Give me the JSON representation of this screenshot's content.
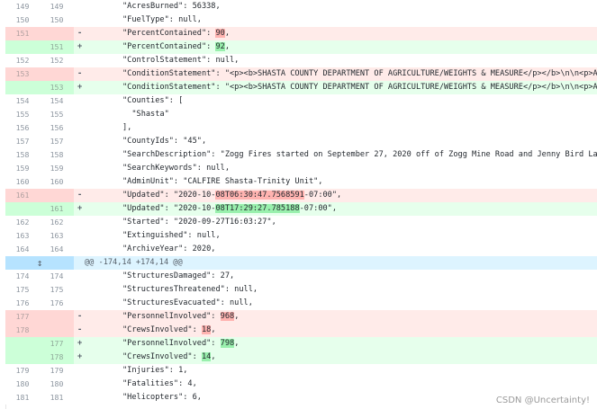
{
  "colors": {
    "del_bg": "#ffebe9",
    "del_gutter": "#ffd7d5",
    "add_bg": "#e6ffec",
    "add_gutter": "#ccffd8",
    "hunk_bg": "#ddf4ff",
    "word_del": "#ffb3b0",
    "word_add": "#99f0ad"
  },
  "expand_icon": "expand-icon",
  "rows": [
    {
      "type": "ctx",
      "old": "149",
      "new": "149",
      "sign": "",
      "pre": "\"AcresBurned\": 56338,",
      "hl": "",
      "post": ""
    },
    {
      "type": "ctx",
      "old": "150",
      "new": "150",
      "sign": "",
      "pre": "\"FuelType\": null,",
      "hl": "",
      "post": ""
    },
    {
      "type": "del",
      "old": "151",
      "new": "",
      "sign": "-",
      "pre": "\"PercentContained\": ",
      "hl": "90",
      "post": ","
    },
    {
      "type": "add",
      "old": "",
      "new": "151",
      "sign": "+",
      "pre": "\"PercentContained\": ",
      "hl": "92",
      "post": ","
    },
    {
      "type": "ctx",
      "old": "152",
      "new": "152",
      "sign": "",
      "pre": "\"ControlStatement\": null,",
      "hl": "",
      "post": ""
    },
    {
      "type": "del",
      "old": "153",
      "new": "",
      "sign": "-",
      "pre": "\"ConditionStatement\": \"<p><b>SHASTA COUNTY DEPARTMENT OF AGRICULTURE/WEIGHTS & MEASURE</p></b>\\n\\n<p>As",
      "hl": "",
      "post": ""
    },
    {
      "type": "add",
      "old": "",
      "new": "153",
      "sign": "+",
      "pre": "\"ConditionStatement\": \"<p><b>SHASTA COUNTY DEPARTMENT OF AGRICULTURE/WEIGHTS & MEASURE</p></b>\\n\\n<p>As",
      "hl": "",
      "post": ""
    },
    {
      "type": "ctx",
      "old": "154",
      "new": "154",
      "sign": "",
      "pre": "\"Counties\": [",
      "hl": "",
      "post": ""
    },
    {
      "type": "ctx",
      "old": "155",
      "new": "155",
      "sign": "",
      "pre": "  \"Shasta\"",
      "hl": "",
      "post": ""
    },
    {
      "type": "ctx",
      "old": "156",
      "new": "156",
      "sign": "",
      "pre": "],",
      "hl": "",
      "post": ""
    },
    {
      "type": "ctx",
      "old": "157",
      "new": "157",
      "sign": "",
      "pre": "\"CountyIds\": \"45\",",
      "hl": "",
      "post": ""
    },
    {
      "type": "ctx",
      "old": "158",
      "new": "158",
      "sign": "",
      "pre": "\"SearchDescription\": \"Zogg Fires started on September 27, 2020 off of Zogg Mine Road and Jenny Bird Lane",
      "hl": "",
      "post": ""
    },
    {
      "type": "ctx",
      "old": "159",
      "new": "159",
      "sign": "",
      "pre": "\"SearchKeywords\": null,",
      "hl": "",
      "post": ""
    },
    {
      "type": "ctx",
      "old": "160",
      "new": "160",
      "sign": "",
      "pre": "\"AdminUnit\": \"CALFIRE Shasta-Trinity Unit\",",
      "hl": "",
      "post": ""
    },
    {
      "type": "del",
      "old": "161",
      "new": "",
      "sign": "-",
      "pre": "\"Updated\": \"2020-10-",
      "hl": "08T06:30:47.7568591",
      "post": "-07:00\","
    },
    {
      "type": "add",
      "old": "",
      "new": "161",
      "sign": "+",
      "pre": "\"Updated\": \"2020-10-",
      "hl": "08T17:29:27.785188",
      "post": "-07:00\","
    },
    {
      "type": "ctx",
      "old": "162",
      "new": "162",
      "sign": "",
      "pre": "\"Started\": \"2020-09-27T16:03:27\",",
      "hl": "",
      "post": ""
    },
    {
      "type": "ctx",
      "old": "163",
      "new": "163",
      "sign": "",
      "pre": "\"Extinguished\": null,",
      "hl": "",
      "post": ""
    },
    {
      "type": "ctx",
      "old": "164",
      "new": "164",
      "sign": "",
      "pre": "\"ArchiveYear\": 2020,",
      "hl": "",
      "post": ""
    },
    {
      "type": "hunk",
      "old": "",
      "new": "",
      "sign": "",
      "pre": "@@ -174,14 +174,14 @@",
      "hl": "",
      "post": ""
    },
    {
      "type": "ctx",
      "old": "174",
      "new": "174",
      "sign": "",
      "pre": "\"StructuresDamaged\": 27,",
      "hl": "",
      "post": ""
    },
    {
      "type": "ctx",
      "old": "175",
      "new": "175",
      "sign": "",
      "pre": "\"StructuresThreatened\": null,",
      "hl": "",
      "post": ""
    },
    {
      "type": "ctx",
      "old": "176",
      "new": "176",
      "sign": "",
      "pre": "\"StructuresEvacuated\": null,",
      "hl": "",
      "post": ""
    },
    {
      "type": "del",
      "old": "177",
      "new": "",
      "sign": "-",
      "pre": "\"PersonnelInvolved\": ",
      "hl": "968",
      "post": ","
    },
    {
      "type": "del",
      "old": "178",
      "new": "",
      "sign": "-",
      "pre": "\"CrewsInvolved\": ",
      "hl": "18",
      "post": ","
    },
    {
      "type": "add",
      "old": "",
      "new": "177",
      "sign": "+",
      "pre": "\"PersonnelInvolved\": ",
      "hl": "798",
      "post": ","
    },
    {
      "type": "add",
      "old": "",
      "new": "178",
      "sign": "+",
      "pre": "\"CrewsInvolved\": ",
      "hl": "14",
      "post": ","
    },
    {
      "type": "ctx",
      "old": "179",
      "new": "179",
      "sign": "",
      "pre": "\"Injuries\": 1,",
      "hl": "",
      "post": ""
    },
    {
      "type": "ctx",
      "old": "180",
      "new": "180",
      "sign": "",
      "pre": "\"Fatalities\": 4,",
      "hl": "",
      "post": ""
    },
    {
      "type": "ctx",
      "old": "181",
      "new": "181",
      "sign": "",
      "pre": "\"Helicopters\": 6,",
      "hl": "",
      "post": ""
    }
  ],
  "watermark": "CSDN @Uncertainty!"
}
